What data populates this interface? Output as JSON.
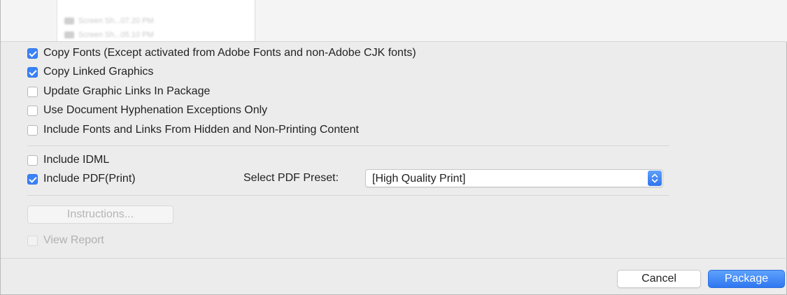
{
  "file_browser": {
    "rows": [
      {
        "icon": "image-file-icon",
        "label": "Screen Sh...07.20 PM"
      },
      {
        "icon": "image-file-icon",
        "label": "Screen Sh...05.10 PM"
      }
    ]
  },
  "options": [
    {
      "label": "Copy Fonts (Except activated from Adobe Fonts and non-Adobe CJK fonts)",
      "checked": true
    },
    {
      "label": "Copy Linked Graphics",
      "checked": true
    },
    {
      "label": "Update Graphic Links In Package",
      "checked": false
    },
    {
      "label": "Use Document Hyphenation Exceptions Only",
      "checked": false
    },
    {
      "label": "Include Fonts and Links From Hidden and Non-Printing Content",
      "checked": false
    }
  ],
  "include_idml": {
    "label": "Include IDML",
    "checked": false
  },
  "include_pdf": {
    "label": "Include PDF(Print)",
    "checked": true
  },
  "pdf_preset": {
    "label": "Select PDF Preset:",
    "value": "[High Quality Print]",
    "icon": "up-down-chevron-icon"
  },
  "instructions_button": {
    "label": "Instructions...",
    "enabled": false
  },
  "view_report": {
    "label": "View Report",
    "checked": false,
    "enabled": false
  },
  "footer": {
    "cancel_label": "Cancel",
    "package_label": "Package"
  },
  "colors": {
    "accent": "#3a82f7",
    "dialog_background": "#ececec"
  }
}
